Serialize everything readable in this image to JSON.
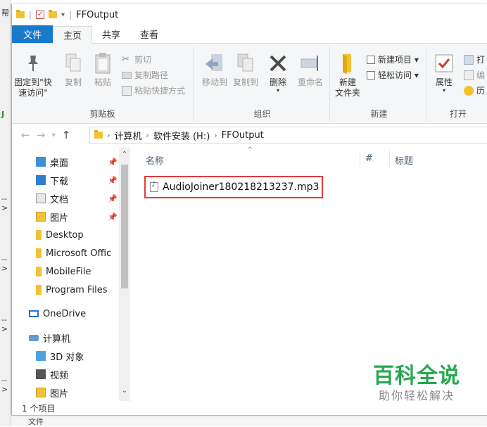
{
  "window": {
    "title": "FFOutput"
  },
  "background": {
    "left_fragments": [
      "帮",
      "-->",
      "-->",
      "-->",
      "-->",
      "J"
    ],
    "bottom_fragment": "文件"
  },
  "ribbon_tabs": [
    "文件",
    "主页",
    "共享",
    "查看"
  ],
  "ribbon": {
    "clipboard": {
      "pin_label": "固定到\"快速访问\"",
      "copy_label": "复制",
      "paste_label": "粘贴",
      "cut_label": "剪切",
      "copy_path_label": "复制路径",
      "paste_shortcut_label": "粘贴快捷方式",
      "group_label": "剪贴板"
    },
    "organize": {
      "move_to_label": "移动到",
      "copy_to_label": "复制到",
      "delete_label": "删除",
      "rename_label": "重命名",
      "group_label": "组织"
    },
    "new": {
      "new_folder_label": "新建\n文件夹",
      "new_item_label": "新建项目 ▾",
      "easy_access_label": "轻松访问 ▾",
      "group_label": "新建"
    },
    "open": {
      "properties_label": "属性",
      "open_label": "打",
      "edit_label": "编",
      "history_label": "历",
      "group_label": "打开"
    }
  },
  "address": {
    "crumbs": [
      "计算机",
      "软件安装 (H:)",
      "FFOutput"
    ]
  },
  "nav_pane": {
    "items": [
      {
        "label": "桌面",
        "icon": "desktop-icon",
        "pinned": true
      },
      {
        "label": "下载",
        "icon": "download-icon",
        "pinned": true
      },
      {
        "label": "文档",
        "icon": "document-icon",
        "pinned": true
      },
      {
        "label": "图片",
        "icon": "pictures-icon",
        "pinned": true
      },
      {
        "label": "Desktop",
        "icon": "folder-icon",
        "pinned": false
      },
      {
        "label": "Microsoft Offic",
        "icon": "folder-icon",
        "pinned": false
      },
      {
        "label": "MobileFile",
        "icon": "folder-icon",
        "pinned": false
      },
      {
        "label": "Program Files",
        "icon": "folder-icon",
        "pinned": false
      },
      {
        "label": "OneDrive",
        "icon": "onedrive-icon",
        "pinned": false
      },
      {
        "label": "计算机",
        "icon": "computer-icon",
        "pinned": false
      },
      {
        "label": "3D 对象",
        "icon": "3d-objects-icon",
        "pinned": false
      },
      {
        "label": "视频",
        "icon": "video-icon",
        "pinned": false
      },
      {
        "label": "图片",
        "icon": "pictures-icon",
        "pinned": false
      }
    ]
  },
  "content": {
    "columns": [
      "名称",
      "#",
      "标题"
    ],
    "files": [
      {
        "name": "AudioJoiner180218213237.mp3",
        "icon": "mp3-file-icon"
      }
    ]
  },
  "status": {
    "item_count": "1 个项目"
  },
  "watermark": {
    "main": "百科全说",
    "sub": "助你轻松解决"
  },
  "colors": {
    "file_tab": "#1979ca",
    "highlight_border": "#e23b3b",
    "watermark_green": "#27a84f"
  }
}
